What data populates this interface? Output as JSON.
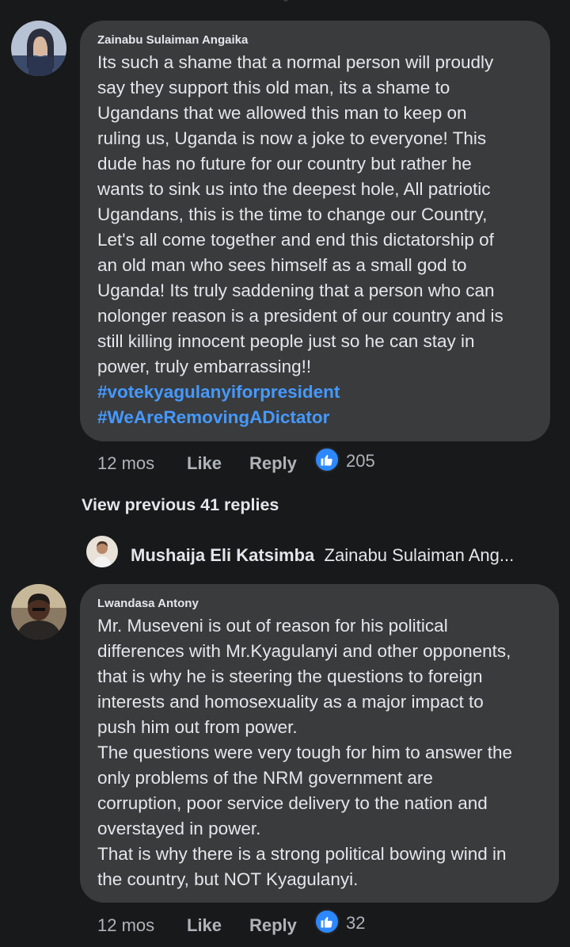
{
  "comments": [
    {
      "author": "Zainabu Sulaiman Angaika",
      "text": "Its such a shame that a normal person will proudly\nsay they support this old man, its a shame to\nUgandans that we allowed this man to keep on\nruling us, Uganda is now a joke to everyone! This\ndude has no future for our country but rather he\nwants to sink us into the deepest hole, All patriotic\nUgandans, this is the time to change our Country,\nLet's all come together and end this dictatorship of\nan old man who sees himself as a small god to\nUganda! Its truly saddening that a person who can\nnolonger reason is a president of our country and is\nstill killing innocent people just so he can stay in\npower, truly embarrassing!!",
      "hashtags": [
        "#votekyagulanyiforpresident",
        "#WeAreRemovingADictator"
      ],
      "time": "12 mos",
      "like_label": "Like",
      "reply_label": "Reply",
      "reaction_count": "205",
      "reaction_icon": "thumbs-up-icon"
    },
    {
      "author": "Lwandasa Antony",
      "text": "Mr. Museveni is out of reason for his political\ndifferences with Mr.Kyagulanyi and other opponents,\nthat is why he is steering the questions to foreign\ninterests and homosexuality as a major impact to\npush him out from power.\nThe questions were very tough for him to answer the\nonly problems of the NRM government are\ncorruption, poor service delivery to the nation and\noverstayed in power.\nThat is why there is a strong political bowing wind in\nthe country, but NOT Kyagulanyi.",
      "time": "12 mos",
      "like_label": "Like",
      "reply_label": "Reply",
      "reaction_count": "32",
      "reaction_icon": "thumbs-up-icon"
    }
  ],
  "view_previous_label": "View previous 41 replies",
  "reply_preview": {
    "name": "Mushaija Eli Katsimba",
    "snippet": "Zainabu Sulaiman Ang..."
  },
  "colors": {
    "background": "#18191a",
    "bubble": "#3a3b3c",
    "text": "#e4e6eb",
    "secondary_text": "#b0b3b8",
    "hashtag": "#4599ff",
    "like_blue": "#2d88ff"
  }
}
